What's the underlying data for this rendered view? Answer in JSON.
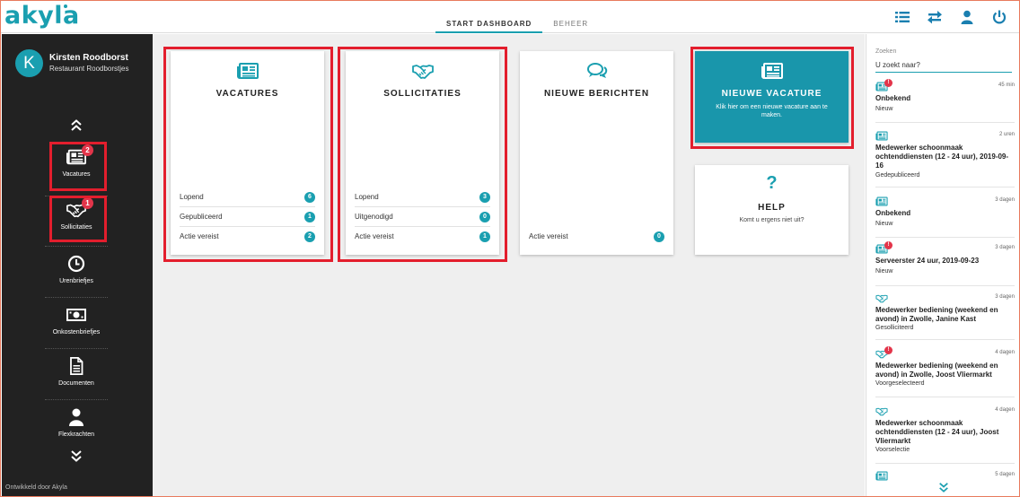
{
  "app": {
    "logo": "akyla"
  },
  "tabs": [
    {
      "label": "START DASHBOARD",
      "active": true
    },
    {
      "label": "BEHEER",
      "active": false
    }
  ],
  "top_icons": [
    "list-icon",
    "swap-icon",
    "user-icon",
    "power-icon"
  ],
  "user": {
    "initial": "K",
    "name": "Kirsten Roodborst",
    "company": "Restaurant Roodborstjes"
  },
  "nav": [
    {
      "label": "Vacatures",
      "icon": "newspaper-icon",
      "badge": "2"
    },
    {
      "label": "Sollicitaties",
      "icon": "handshake-icon",
      "badge": "1"
    },
    {
      "label": "Urenbriefjes",
      "icon": "clock-icon",
      "badge": ""
    },
    {
      "label": "Onkostenbriefjes",
      "icon": "money-icon",
      "badge": ""
    },
    {
      "label": "Documenten",
      "icon": "document-icon",
      "badge": ""
    },
    {
      "label": "Flexkrachten",
      "icon": "person-icon",
      "badge": ""
    }
  ],
  "footer": "Ontwikkeld door Akyla",
  "cards": {
    "vacatures": {
      "title": "VACATURES",
      "rows": [
        {
          "label": "Lopend",
          "count": "6"
        },
        {
          "label": "Gepubliceerd",
          "count": "1"
        },
        {
          "label": "Actie vereist",
          "count": "2"
        }
      ]
    },
    "sollicitaties": {
      "title": "SOLLICITATIES",
      "rows": [
        {
          "label": "Lopend",
          "count": "3"
        },
        {
          "label": "Uitgenodigd",
          "count": "0"
        },
        {
          "label": "Actie vereist",
          "count": "1"
        }
      ]
    },
    "berichten": {
      "title": "NIEUWE BERICHTEN",
      "rows": [
        {
          "label": "Actie vereist",
          "count": "0"
        }
      ]
    },
    "nieuwe_vacature": {
      "title": "NIEUWE VACATURE",
      "subtitle": "Klik hier om een nieuwe vacature aan te maken."
    },
    "help": {
      "title": "HELP",
      "subtitle": "Komt u ergens niet uit?"
    }
  },
  "search": {
    "label": "Zoeken",
    "placeholder": "U zoekt naar?"
  },
  "notifications": [
    {
      "icon": "newspaper-icon",
      "alert": "!",
      "time": "45 min",
      "title": "Onbekend",
      "status": "Nieuw"
    },
    {
      "icon": "newspaper-icon",
      "alert": "",
      "time": "2 uren",
      "title": "Medewerker schoonmaak ochtenddiensten (12 - 24 uur), 2019-09-16",
      "status": "Gedepubliceerd"
    },
    {
      "icon": "newspaper-icon",
      "alert": "",
      "time": "3 dagen",
      "title": "Onbekend",
      "status": "Nieuw"
    },
    {
      "icon": "newspaper-icon",
      "alert": "!",
      "time": "3 dagen",
      "title": "Serveerster 24 uur, 2019-09-23",
      "status": "Nieuw"
    },
    {
      "icon": "handshake-icon",
      "alert": "",
      "time": "3 dagen",
      "title": "Medewerker bediening (weekend en avond) in Zwolle, Janine Kast",
      "status": "Gesolliciteerd"
    },
    {
      "icon": "handshake-icon",
      "alert": "!",
      "time": "4 dagen",
      "title": "Medewerker bediening (weekend en avond) in Zwolle, Joost Vliermarkt",
      "status": "Voorgeselecteerd"
    },
    {
      "icon": "handshake-icon",
      "alert": "",
      "time": "4 dagen",
      "title": "Medewerker schoonmaak ochtenddiensten (12 - 24 uur), Joost Vliermarkt",
      "status": "Voorselectie"
    },
    {
      "icon": "newspaper-icon",
      "alert": "",
      "time": "5 dagen",
      "title": "",
      "status": ""
    }
  ],
  "colors": {
    "accent": "#1a9fb0",
    "sidebar": "#222222",
    "badge": "#e3354a",
    "highlight": "#e31e2d",
    "card_teal": "#1996ab"
  }
}
